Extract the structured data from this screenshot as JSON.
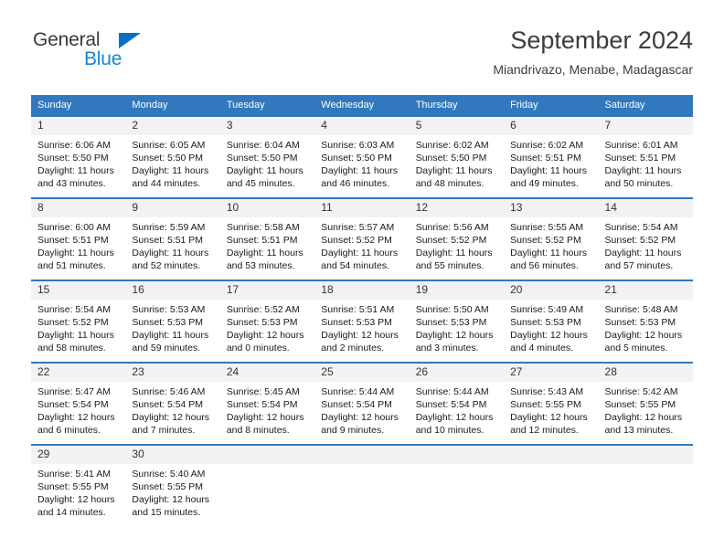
{
  "brand": {
    "name_top": "General",
    "name_bottom": "Blue",
    "accent_color": "#1585d4",
    "triangle_color": "#0b6ec4"
  },
  "header": {
    "title": "September 2024",
    "subtitle": "Miandrivazo, Menabe, Madagascar"
  },
  "theme": {
    "header_blue": "#3178be",
    "daynum_band": "#f2f2f2",
    "text": "#1a1a1a"
  },
  "calendar": {
    "weekday_headers": [
      "Sunday",
      "Monday",
      "Tuesday",
      "Wednesday",
      "Thursday",
      "Friday",
      "Saturday"
    ],
    "weeks": [
      [
        {
          "day": "1",
          "sunrise": "Sunrise: 6:06 AM",
          "sunset": "Sunset: 5:50 PM",
          "daylight1": "Daylight: 11 hours",
          "daylight2": "and 43 minutes."
        },
        {
          "day": "2",
          "sunrise": "Sunrise: 6:05 AM",
          "sunset": "Sunset: 5:50 PM",
          "daylight1": "Daylight: 11 hours",
          "daylight2": "and 44 minutes."
        },
        {
          "day": "3",
          "sunrise": "Sunrise: 6:04 AM",
          "sunset": "Sunset: 5:50 PM",
          "daylight1": "Daylight: 11 hours",
          "daylight2": "and 45 minutes."
        },
        {
          "day": "4",
          "sunrise": "Sunrise: 6:03 AM",
          "sunset": "Sunset: 5:50 PM",
          "daylight1": "Daylight: 11 hours",
          "daylight2": "and 46 minutes."
        },
        {
          "day": "5",
          "sunrise": "Sunrise: 6:02 AM",
          "sunset": "Sunset: 5:50 PM",
          "daylight1": "Daylight: 11 hours",
          "daylight2": "and 48 minutes."
        },
        {
          "day": "6",
          "sunrise": "Sunrise: 6:02 AM",
          "sunset": "Sunset: 5:51 PM",
          "daylight1": "Daylight: 11 hours",
          "daylight2": "and 49 minutes."
        },
        {
          "day": "7",
          "sunrise": "Sunrise: 6:01 AM",
          "sunset": "Sunset: 5:51 PM",
          "daylight1": "Daylight: 11 hours",
          "daylight2": "and 50 minutes."
        }
      ],
      [
        {
          "day": "8",
          "sunrise": "Sunrise: 6:00 AM",
          "sunset": "Sunset: 5:51 PM",
          "daylight1": "Daylight: 11 hours",
          "daylight2": "and 51 minutes."
        },
        {
          "day": "9",
          "sunrise": "Sunrise: 5:59 AM",
          "sunset": "Sunset: 5:51 PM",
          "daylight1": "Daylight: 11 hours",
          "daylight2": "and 52 minutes."
        },
        {
          "day": "10",
          "sunrise": "Sunrise: 5:58 AM",
          "sunset": "Sunset: 5:51 PM",
          "daylight1": "Daylight: 11 hours",
          "daylight2": "and 53 minutes."
        },
        {
          "day": "11",
          "sunrise": "Sunrise: 5:57 AM",
          "sunset": "Sunset: 5:52 PM",
          "daylight1": "Daylight: 11 hours",
          "daylight2": "and 54 minutes."
        },
        {
          "day": "12",
          "sunrise": "Sunrise: 5:56 AM",
          "sunset": "Sunset: 5:52 PM",
          "daylight1": "Daylight: 11 hours",
          "daylight2": "and 55 minutes."
        },
        {
          "day": "13",
          "sunrise": "Sunrise: 5:55 AM",
          "sunset": "Sunset: 5:52 PM",
          "daylight1": "Daylight: 11 hours",
          "daylight2": "and 56 minutes."
        },
        {
          "day": "14",
          "sunrise": "Sunrise: 5:54 AM",
          "sunset": "Sunset: 5:52 PM",
          "daylight1": "Daylight: 11 hours",
          "daylight2": "and 57 minutes."
        }
      ],
      [
        {
          "day": "15",
          "sunrise": "Sunrise: 5:54 AM",
          "sunset": "Sunset: 5:52 PM",
          "daylight1": "Daylight: 11 hours",
          "daylight2": "and 58 minutes."
        },
        {
          "day": "16",
          "sunrise": "Sunrise: 5:53 AM",
          "sunset": "Sunset: 5:53 PM",
          "daylight1": "Daylight: 11 hours",
          "daylight2": "and 59 minutes."
        },
        {
          "day": "17",
          "sunrise": "Sunrise: 5:52 AM",
          "sunset": "Sunset: 5:53 PM",
          "daylight1": "Daylight: 12 hours",
          "daylight2": "and 0 minutes."
        },
        {
          "day": "18",
          "sunrise": "Sunrise: 5:51 AM",
          "sunset": "Sunset: 5:53 PM",
          "daylight1": "Daylight: 12 hours",
          "daylight2": "and 2 minutes."
        },
        {
          "day": "19",
          "sunrise": "Sunrise: 5:50 AM",
          "sunset": "Sunset: 5:53 PM",
          "daylight1": "Daylight: 12 hours",
          "daylight2": "and 3 minutes."
        },
        {
          "day": "20",
          "sunrise": "Sunrise: 5:49 AM",
          "sunset": "Sunset: 5:53 PM",
          "daylight1": "Daylight: 12 hours",
          "daylight2": "and 4 minutes."
        },
        {
          "day": "21",
          "sunrise": "Sunrise: 5:48 AM",
          "sunset": "Sunset: 5:53 PM",
          "daylight1": "Daylight: 12 hours",
          "daylight2": "and 5 minutes."
        }
      ],
      [
        {
          "day": "22",
          "sunrise": "Sunrise: 5:47 AM",
          "sunset": "Sunset: 5:54 PM",
          "daylight1": "Daylight: 12 hours",
          "daylight2": "and 6 minutes."
        },
        {
          "day": "23",
          "sunrise": "Sunrise: 5:46 AM",
          "sunset": "Sunset: 5:54 PM",
          "daylight1": "Daylight: 12 hours",
          "daylight2": "and 7 minutes."
        },
        {
          "day": "24",
          "sunrise": "Sunrise: 5:45 AM",
          "sunset": "Sunset: 5:54 PM",
          "daylight1": "Daylight: 12 hours",
          "daylight2": "and 8 minutes."
        },
        {
          "day": "25",
          "sunrise": "Sunrise: 5:44 AM",
          "sunset": "Sunset: 5:54 PM",
          "daylight1": "Daylight: 12 hours",
          "daylight2": "and 9 minutes."
        },
        {
          "day": "26",
          "sunrise": "Sunrise: 5:44 AM",
          "sunset": "Sunset: 5:54 PM",
          "daylight1": "Daylight: 12 hours",
          "daylight2": "and 10 minutes."
        },
        {
          "day": "27",
          "sunrise": "Sunrise: 5:43 AM",
          "sunset": "Sunset: 5:55 PM",
          "daylight1": "Daylight: 12 hours",
          "daylight2": "and 12 minutes."
        },
        {
          "day": "28",
          "sunrise": "Sunrise: 5:42 AM",
          "sunset": "Sunset: 5:55 PM",
          "daylight1": "Daylight: 12 hours",
          "daylight2": "and 13 minutes."
        }
      ],
      [
        {
          "day": "29",
          "sunrise": "Sunrise: 5:41 AM",
          "sunset": "Sunset: 5:55 PM",
          "daylight1": "Daylight: 12 hours",
          "daylight2": "and 14 minutes."
        },
        {
          "day": "30",
          "sunrise": "Sunrise: 5:40 AM",
          "sunset": "Sunset: 5:55 PM",
          "daylight1": "Daylight: 12 hours",
          "daylight2": "and 15 minutes."
        },
        {
          "day": "",
          "sunrise": "",
          "sunset": "",
          "daylight1": "",
          "daylight2": ""
        },
        {
          "day": "",
          "sunrise": "",
          "sunset": "",
          "daylight1": "",
          "daylight2": ""
        },
        {
          "day": "",
          "sunrise": "",
          "sunset": "",
          "daylight1": "",
          "daylight2": ""
        },
        {
          "day": "",
          "sunrise": "",
          "sunset": "",
          "daylight1": "",
          "daylight2": ""
        },
        {
          "day": "",
          "sunrise": "",
          "sunset": "",
          "daylight1": "",
          "daylight2": ""
        }
      ]
    ]
  }
}
